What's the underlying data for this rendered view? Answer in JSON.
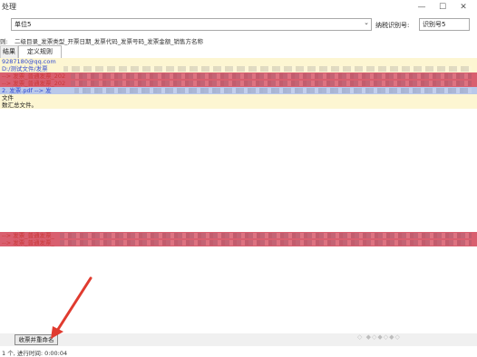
{
  "window": {
    "title": "处理",
    "controls": {
      "minimize": "—",
      "maximize": "☐",
      "close": "✕"
    }
  },
  "unit_select": {
    "value": "单位5"
  },
  "taxpayer": {
    "label": "纳税识别号:",
    "value": "识别号5"
  },
  "rename_rule": {
    "label": "则:",
    "text": "二级目录_发票类型_开票日期_发票代码_发票号码_发票金额_销售方名称"
  },
  "tabs": [
    {
      "label": "结果"
    },
    {
      "label": "定义规则"
    }
  ],
  "log_lines": [
    {
      "text": "9287180@qq.com",
      "color": "#2f49d1",
      "bg": "#fdf6d2",
      "blur": false
    },
    {
      "text": "D:/测试文件/发票",
      "color": "#2f49d1",
      "bg": "#fdf6d2",
      "blur": true
    },
    {
      "text": "--> 发票_普通发票_202",
      "color": "#c83838",
      "bg": "#d95f6f",
      "blur": true
    },
    {
      "text": "--> 发票_普通发票_202",
      "color": "#c83838",
      "bg": "#d95f6f",
      "blur": true
    },
    {
      "text": "2. 发票.pdf --> 发",
      "color": "#2f49d1",
      "bg": "#b9c8ea",
      "blur": true
    },
    {
      "text": "文件",
      "color": "#222222",
      "bg": "#fdf6d2",
      "blur": false
    },
    {
      "text": "数汇总文件。",
      "color": "#222222",
      "bg": "#fdf6d2",
      "blur": false
    },
    {
      "text": "--> 发票_普通发票_",
      "color": "#c83838",
      "bg": "#d95f6f",
      "blur": true
    },
    {
      "text": "--> 发票_普通发票_",
      "color": "#c83838",
      "bg": "#d95f6f",
      "blur": true
    }
  ],
  "collect_button": {
    "label": "收票并重命名"
  },
  "status_bar": {
    "text": "1 个, 进行时间: 0:00:04"
  },
  "watermark": {
    "text": "◇ ◆◇◆◇◆◇"
  },
  "colors": {
    "highlight_yellow": "#fdf6d2",
    "highlight_red": "#d95f6f",
    "highlight_blue": "#b9c8ea",
    "arrow": "#e03b2f"
  }
}
